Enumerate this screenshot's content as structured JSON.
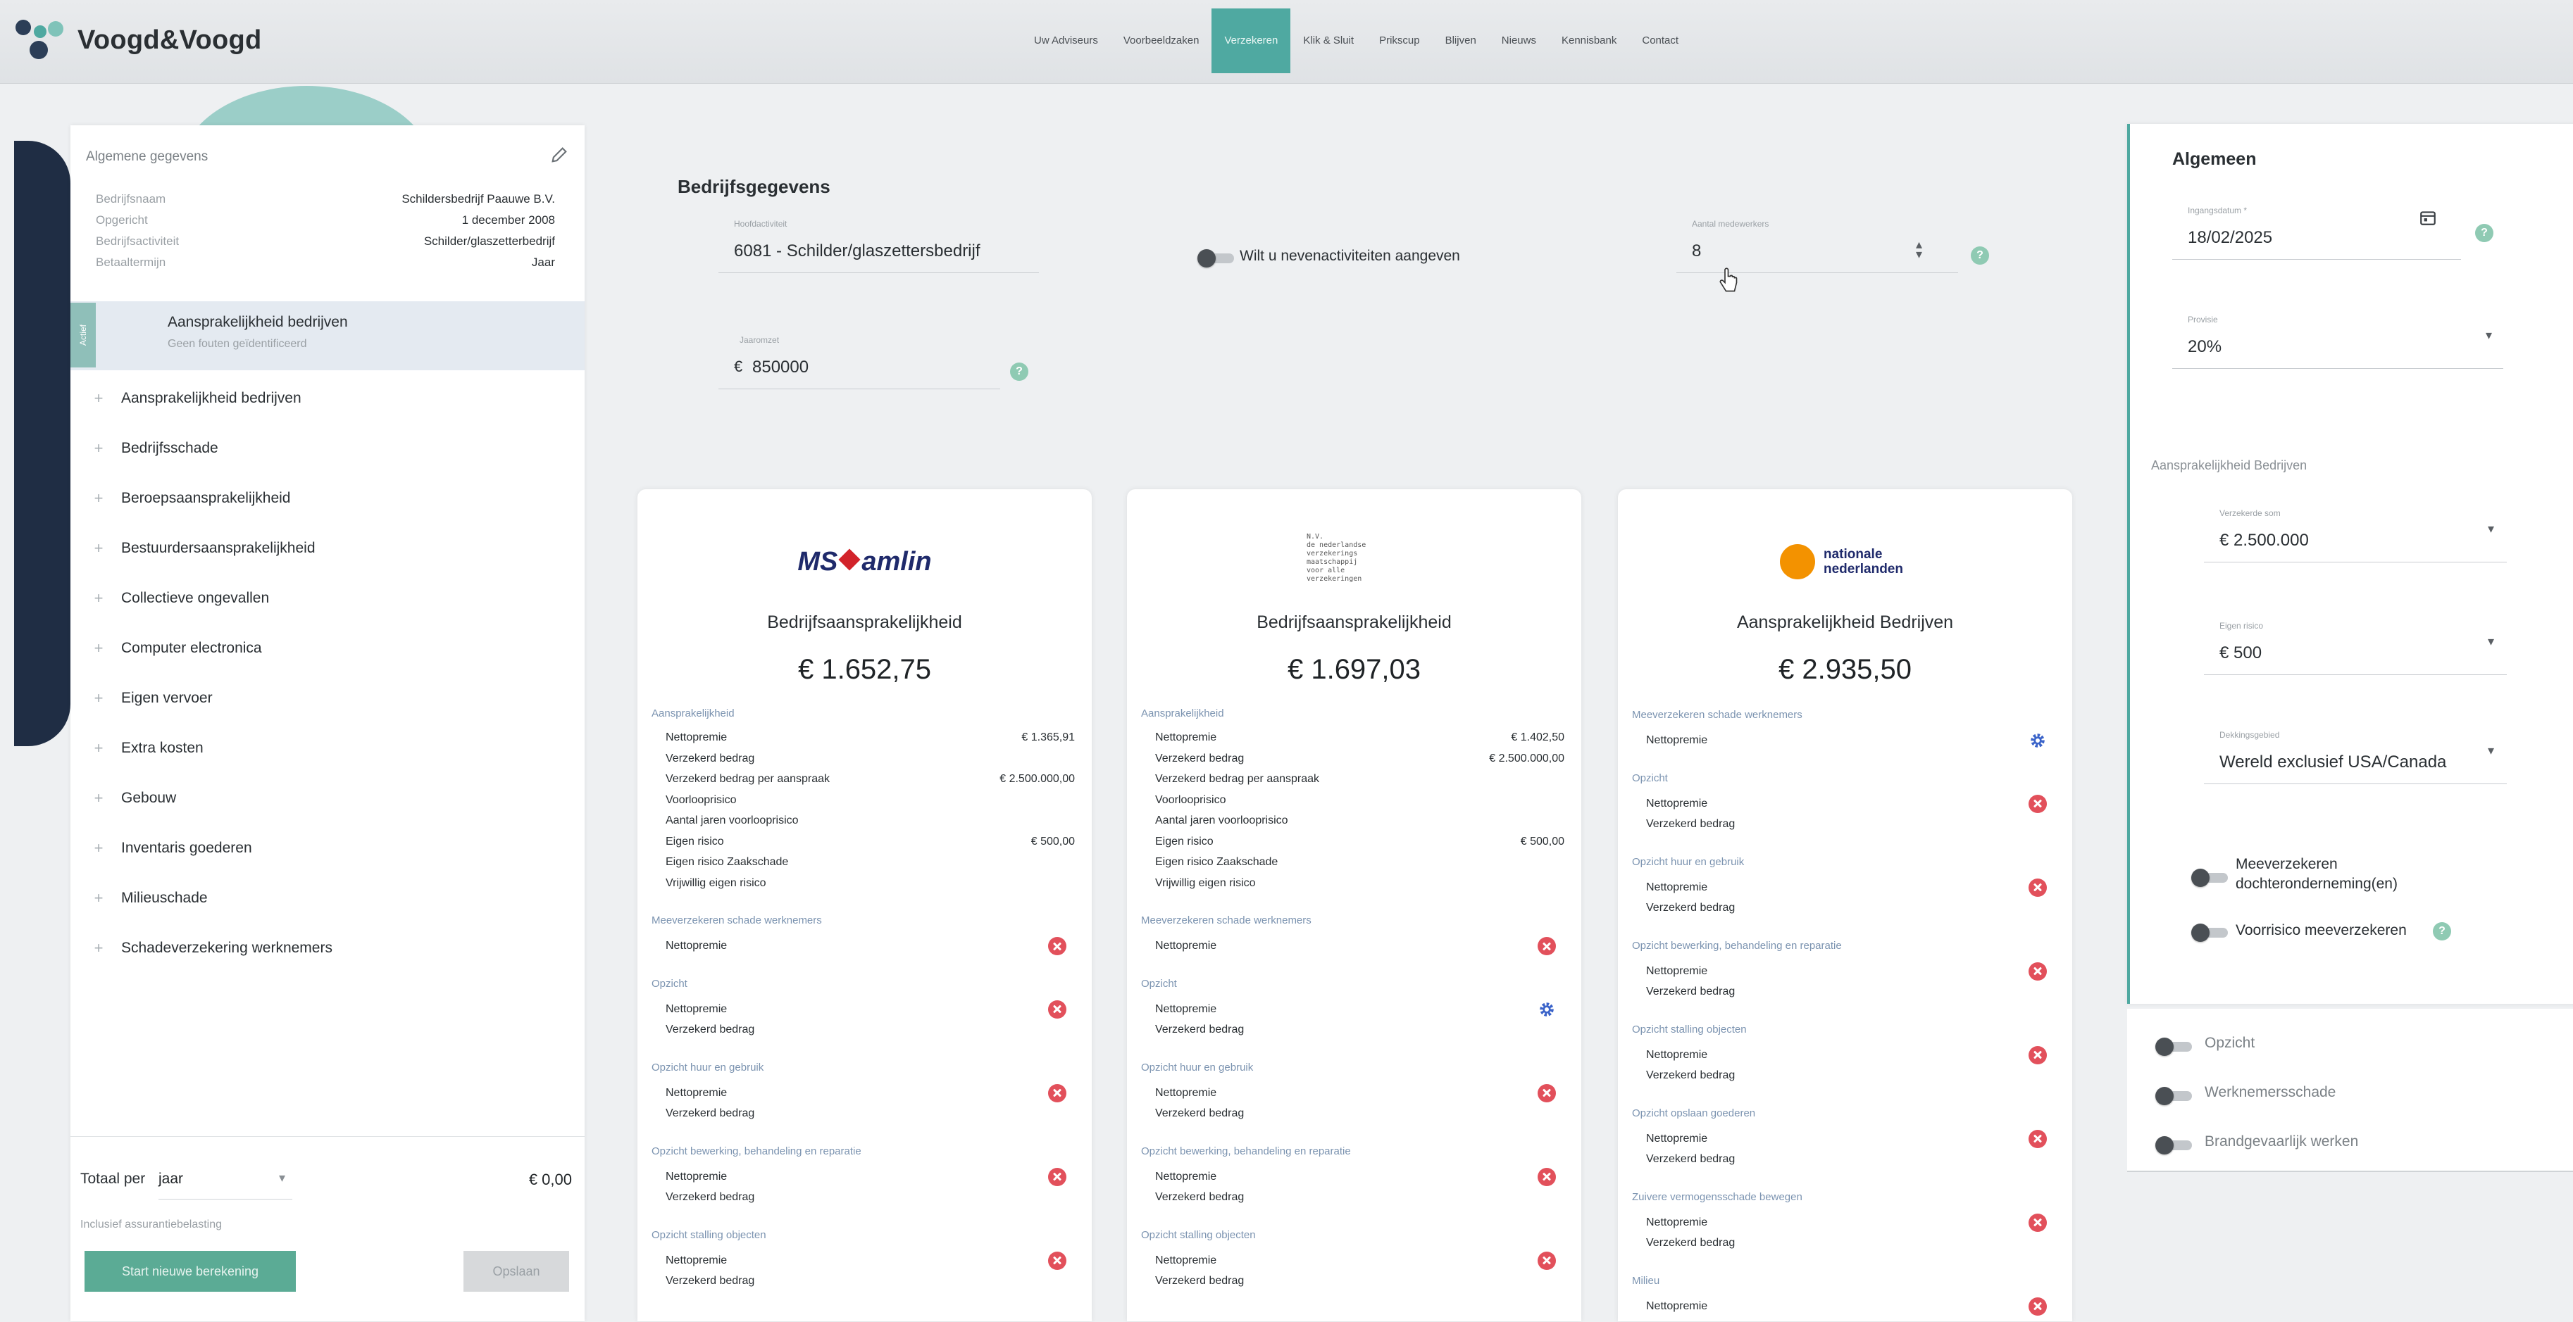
{
  "brand": {
    "name": "Voogd&Voogd",
    "accent": "#4fa9a1",
    "green": "#5bab95",
    "navy": "#1f2d44"
  },
  "nav": {
    "items": [
      "Uw Adviseurs",
      "Voorbeeldzaken",
      "Verzekeren",
      "Klik & Sluit",
      "Prikscup",
      "Blijven",
      "Nieuws",
      "Kennisbank",
      "Contact"
    ],
    "active_index": 2
  },
  "general": {
    "title": "Algemene gegevens",
    "rows": [
      {
        "label": "Bedrijfsnaam",
        "value": "Schildersbedrijf Paauwe B.V."
      },
      {
        "label": "Opgericht",
        "value": "1 december 2008"
      },
      {
        "label": "Bedrijfsactiviteit",
        "value": "Schilder/glaszetterbedrijf"
      },
      {
        "label": "Betaaltermijn",
        "value": "Jaar"
      }
    ]
  },
  "selected_product": {
    "title": "Aansprakelijkheid bedrijven",
    "subtitle": "Geen fouten geïdentificeerd",
    "tab": "Actief"
  },
  "products": [
    "Aansprakelijkheid bedrijven",
    "Bedrijfsschade",
    "Beroepsaansprakelijkheid",
    "Bestuurdersaansprakelijkheid",
    "Collectieve ongevallen",
    "Computer electronica",
    "Eigen vervoer",
    "Extra kosten",
    "Gebouw",
    "Inventaris goederen",
    "Milieuschade",
    "Schadeverzekering werknemers"
  ],
  "totals": {
    "label": "Totaal per",
    "period": "jaar",
    "amount": "€ 0,00",
    "hint": "Inclusief assurantiebelasting",
    "start_button": "Start nieuwe berekening",
    "save_button": "Opslaan"
  },
  "company": {
    "title": "Bedrijfsgegevens",
    "activity_label": "Hoofdactiviteit",
    "activity_value": "6081 - Schilder/glaszettersbedrijf",
    "side_activities_label": "Wilt u nevenactiviteiten aangeven",
    "employees_label": "Aantal medewerkers",
    "employees_value": "8",
    "revenue_label": "Jaaromzet",
    "revenue_currency": "€",
    "revenue_value": "850000"
  },
  "cards": [
    {
      "insurer": "MS Amlin",
      "logo_text": "MS",
      "logo_text2": "amlin",
      "product": "Bedrijfsaansprakelijkheid",
      "price": "€ 1.652,75",
      "header": "Aansprakelijkheid",
      "lines": [
        {
          "label": "Nettopremie",
          "value": "€ 1.365,91"
        },
        {
          "label": "Verzekerd bedrag",
          "value": ""
        },
        {
          "label": "Verzekerd bedrag per aanspraak",
          "value": "€ 2.500.000,00"
        },
        {
          "label": "Voorlooprisico",
          "value": ""
        },
        {
          "label": "Aantal jaren voorlooprisico",
          "value": ""
        },
        {
          "label": "Eigen risico",
          "value": "€ 500,00"
        },
        {
          "label": "Eigen risico Zaakschade",
          "value": ""
        },
        {
          "label": "Vrijwillig eigen risico",
          "value": ""
        }
      ],
      "sections": [
        {
          "title": "Meeverzekeren schade werknemers",
          "lines": [
            "Nettopremie"
          ],
          "status": "x"
        },
        {
          "title": "Opzicht",
          "lines": [
            "Nettopremie",
            "Verzekerd bedrag"
          ],
          "status": "x"
        },
        {
          "title": "Opzicht huur en gebruik",
          "lines": [
            "Nettopremie",
            "Verzekerd bedrag"
          ],
          "status": "x"
        },
        {
          "title": "Opzicht bewerking, behandeling en reparatie",
          "lines": [
            "Nettopremie",
            "Verzekerd bedrag"
          ],
          "status": "x"
        },
        {
          "title": "Opzicht stalling objecten",
          "lines": [
            "Nettopremie",
            "Verzekerd bedrag"
          ],
          "status": "x"
        }
      ]
    },
    {
      "insurer": "De Nederlandse Verzekerings Maatschappij voor Alle Verzekeringen",
      "logo_lines": [
        "N.V.",
        "de nederlandse",
        "verzekerings",
        "maatschappij",
        "voor alle",
        "verzekeringen"
      ],
      "product": "Bedrijfsaansprakelijkheid",
      "price": "€ 1.697,03",
      "header": "Aansprakelijkheid",
      "lines": [
        {
          "label": "Nettopremie",
          "value": "€ 1.402,50"
        },
        {
          "label": "Verzekerd bedrag",
          "value": "€ 2.500.000,00"
        },
        {
          "label": "Verzekerd bedrag per aanspraak",
          "value": ""
        },
        {
          "label": "Voorlooprisico",
          "value": ""
        },
        {
          "label": "Aantal jaren voorlooprisico",
          "value": ""
        },
        {
          "label": "Eigen risico",
          "value": "€ 500,00"
        },
        {
          "label": "Eigen risico Zaakschade",
          "value": ""
        },
        {
          "label": "Vrijwillig eigen risico",
          "value": ""
        }
      ],
      "sections": [
        {
          "title": "Meeverzekeren schade werknemers",
          "lines": [
            "Nettopremie"
          ],
          "status": "x"
        },
        {
          "title": "Opzicht",
          "lines": [
            "Nettopremie",
            "Verzekerd bedrag"
          ],
          "status": "gear"
        },
        {
          "title": "Opzicht huur en gebruik",
          "lines": [
            "Nettopremie",
            "Verzekerd bedrag"
          ],
          "status": "x"
        },
        {
          "title": "Opzicht bewerking, behandeling en reparatie",
          "lines": [
            "Nettopremie",
            "Verzekerd bedrag"
          ],
          "status": "x"
        },
        {
          "title": "Opzicht stalling objecten",
          "lines": [
            "Nettopremie",
            "Verzekerd bedrag"
          ],
          "status": "x"
        }
      ]
    },
    {
      "insurer": "Nationale Nederlanden",
      "logo_lines": [
        "nationale",
        "nederlanden"
      ],
      "product": "Aansprakelijkheid Bedrijven",
      "price": "€ 2.935,50",
      "sections": [
        {
          "title": "Meeverzekeren schade werknemers",
          "lines": [
            "Nettopremie"
          ],
          "status": "gear"
        },
        {
          "title": "Opzicht",
          "lines": [
            "Nettopremie",
            "Verzekerd bedrag"
          ],
          "status": "x"
        },
        {
          "title": "Opzicht huur en gebruik",
          "lines": [
            "Nettopremie",
            "Verzekerd bedrag"
          ],
          "status": "x"
        },
        {
          "title": "Opzicht bewerking, behandeling en reparatie",
          "lines": [
            "Nettopremie",
            "Verzekerd bedrag"
          ],
          "status": "x"
        },
        {
          "title": "Opzicht stalling objecten",
          "lines": [
            "Nettopremie",
            "Verzekerd bedrag"
          ],
          "status": "x"
        },
        {
          "title": "Opzicht opslaan goederen",
          "lines": [
            "Nettopremie",
            "Verzekerd bedrag"
          ],
          "status": "x"
        },
        {
          "title": "Zuivere vermogensschade bewegen",
          "lines": [
            "Nettopremie",
            "Verzekerd bedrag"
          ],
          "status": "x"
        },
        {
          "title": "Milieu",
          "lines": [
            "Nettopremie"
          ],
          "status": "x"
        }
      ]
    }
  ],
  "right": {
    "title": "Algemeen",
    "date_label": "Ingangsdatum *",
    "date_value": "18/02/2025",
    "provision_label": "Provisie",
    "provision_value": "20%",
    "section_title": "Aansprakelijkheid Bedrijven",
    "insured_label": "Verzekerde som",
    "insured_value": "€ 2.500.000",
    "deductible_label": "Eigen risico",
    "deductible_value": "€ 500",
    "area_label": "Dekkingsgebied",
    "area_value": "Wereld exclusief USA/Canada",
    "toggle1": "Meeverzekeren dochterondernemingen",
    "toggle1_line1": "Meeverzekeren",
    "toggle1_line2": "dochteronderneming(en)",
    "toggle2": "Voorrisico meeverzekeren",
    "sub_items": [
      "Opzicht",
      "Werknemersschade",
      "Brandgevaarlijk werken"
    ]
  }
}
